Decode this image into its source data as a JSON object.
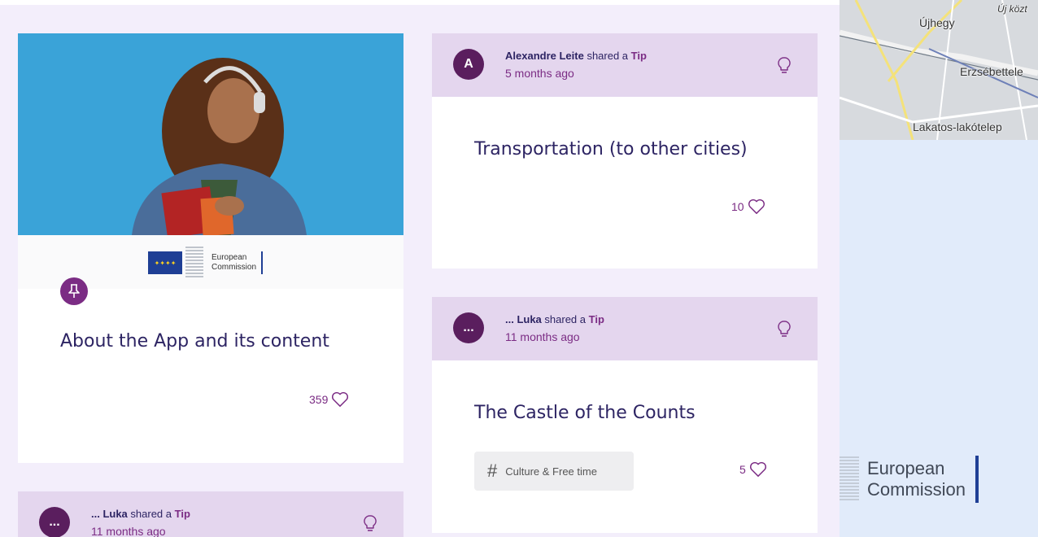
{
  "colors": {
    "background": "#f3eefb",
    "card_header": "#e4d6ee",
    "accent_purple": "#7b2c84",
    "avatar_dark": "#5a1e5e",
    "title_navy": "#2d2463",
    "right_panel": "#e1ebfa"
  },
  "featured_card": {
    "image_icon": "student-with-headphones-photo",
    "logo_text_line1": "European",
    "logo_text_line2": "Commission",
    "pin_icon": "pin-icon",
    "title": "About the App and its content",
    "likes": "359"
  },
  "tip_card_1": {
    "avatar_letter": "A",
    "author": "Alexandre Leite",
    "shared_text": " shared a ",
    "type": "Tip",
    "time": "5 months ago",
    "title": "Transportation (to other cities)",
    "likes": "10"
  },
  "tip_card_2": {
    "avatar_letter": "...",
    "author": "... Luka",
    "shared_text": " shared a ",
    "type": "Tip",
    "time": "11 months ago",
    "title": "The Castle of the Counts",
    "tag": "Culture & Free time",
    "likes": "5"
  },
  "tip_card_3": {
    "avatar_letter": "...",
    "author": "... Luka",
    "shared_text": " shared a ",
    "type": "Tip",
    "time": "11 months ago"
  },
  "map": {
    "labels": [
      "Újhegy",
      "Új közt",
      "Erzsébettele",
      "Lakatos-lakótelep"
    ]
  },
  "footer_logo": {
    "line1": "European",
    "line2": "Commission"
  }
}
